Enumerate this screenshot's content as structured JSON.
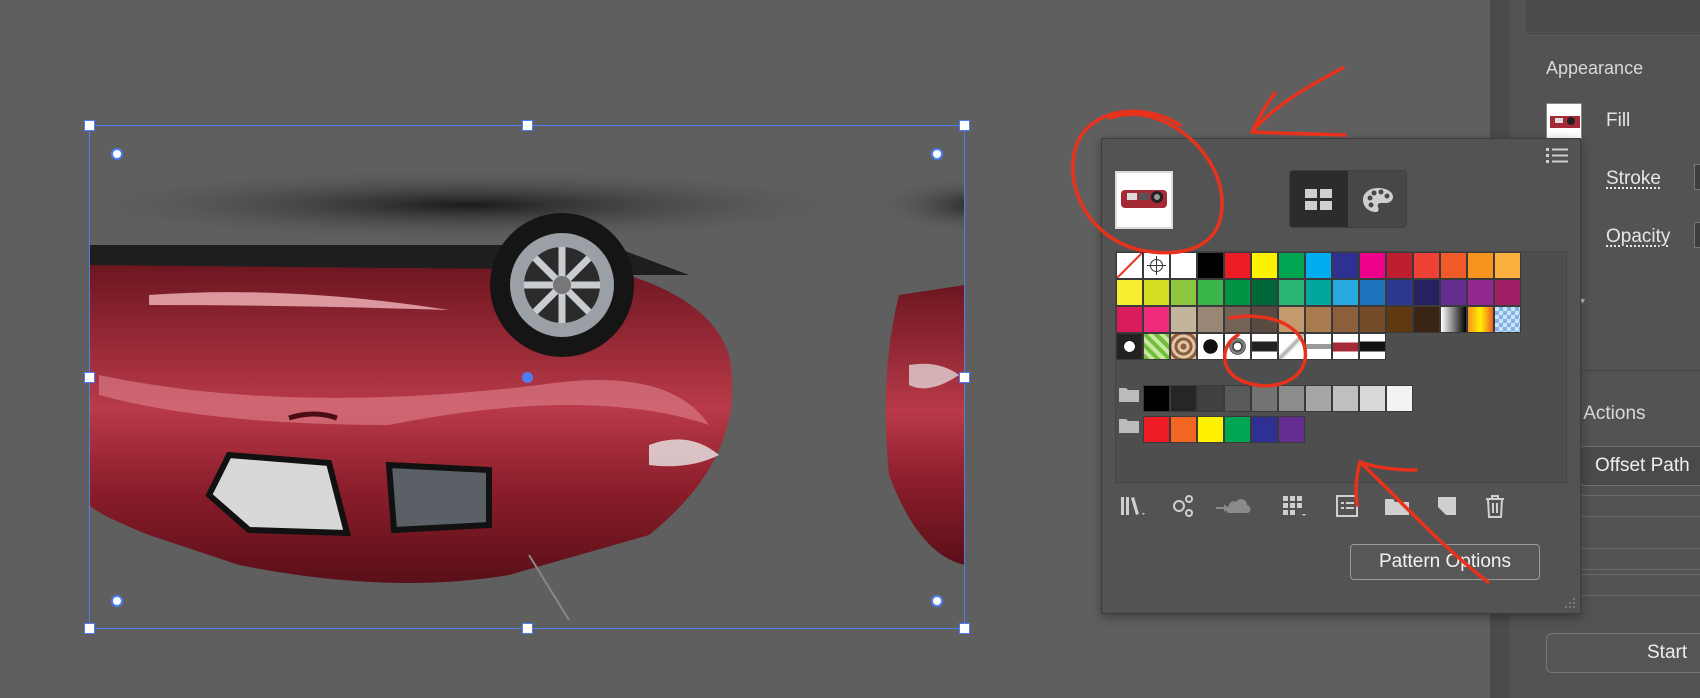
{
  "canvas": {
    "artwork_name": "car-pattern-artwork"
  },
  "properties_panel": {
    "section_title": "Appearance",
    "fill_label": "Fill",
    "stroke_label": "Stroke",
    "opacity_label": "Opacity",
    "quick_actions_label": "ck Actions",
    "offset_path_button": "Offset Path",
    "start_button": "Start"
  },
  "swatches_panel": {
    "pattern_options_button": "Pattern Options",
    "colors": {
      "row1": [
        "#000000",
        "#ed1c24",
        "#fff200",
        "#00a651",
        "#00aeef",
        "#2e3192",
        "#ec008c",
        "#be1e2d",
        "#ef4136",
        "#f15a29",
        "#f7941d",
        "#fbb040"
      ],
      "row2": [
        "#f9ed32",
        "#d7df23",
        "#8dc63f",
        "#39b54a",
        "#009444",
        "#006838",
        "#2bb673",
        "#00a79d",
        "#27aae1",
        "#1c75bc",
        "#2b3990",
        "#262262",
        "#662d91",
        "#92278f",
        "#9e1f63"
      ],
      "row3": [
        "#da1c5c",
        "#ee2a7b",
        "#c2b59b",
        "#998675",
        "#736357",
        "#594a42",
        "#c49a6c",
        "#a97c50",
        "#8b5e3c",
        "#754c29",
        "#603913",
        "#3c2415"
      ],
      "gray_row": [
        "#000000",
        "#262626",
        "#404040",
        "#595959",
        "#737373",
        "#8c8c8c",
        "#a6a6a6",
        "#bfbfbf",
        "#d9d9d9",
        "#f2f2f2"
      ],
      "group_row": [
        "#ed1c24",
        "#f26522",
        "#fff200",
        "#00a651",
        "#2e3192",
        "#662d91"
      ]
    },
    "accent": "#4d7cf3",
    "annotation_color": "#e8321c"
  }
}
